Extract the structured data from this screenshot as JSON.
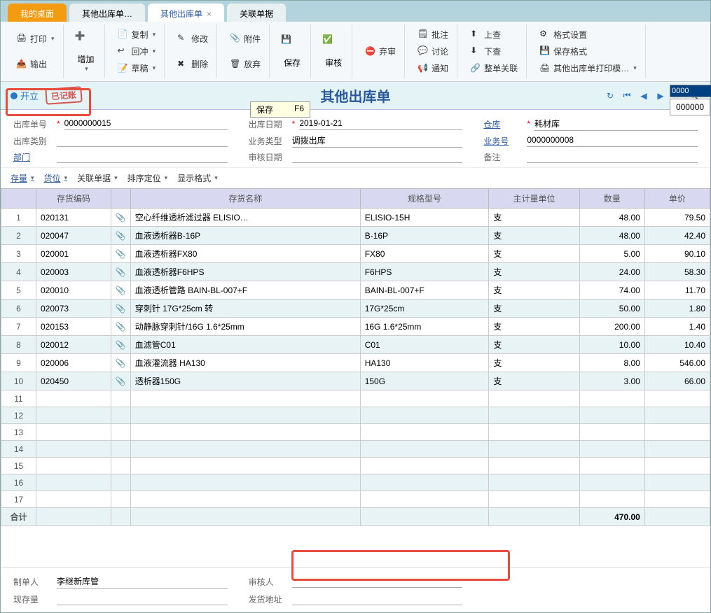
{
  "tabs": [
    {
      "label": "我的桌面",
      "active": "orange"
    },
    {
      "label": "其他出库单…"
    },
    {
      "label": "其他出库单",
      "active": "white",
      "closable": true
    },
    {
      "label": "关联单据"
    }
  ],
  "toolbar": {
    "print": "打印",
    "output": "输出",
    "add": "增加",
    "copy": "复制",
    "back": "回冲",
    "draft": "草稿",
    "modify": "修改",
    "delete": "删除",
    "attach": "附件",
    "discard": "放弃",
    "save": "保存",
    "audit": "审核",
    "unaudit": "弃审",
    "note": "批注",
    "discuss": "讨论",
    "notify": "通知",
    "up_check": "上查",
    "down_check": "下查",
    "link_all": "整单关联",
    "format": "格式设置",
    "save_format": "保存格式",
    "print_tmpl": "其他出库单打印模…"
  },
  "status": {
    "state": "开立",
    "stamp": "已记账",
    "title": "其他出库单",
    "tip_label": "保存",
    "tip_key": "F6",
    "search_value": "0000",
    "search_hint": "000000"
  },
  "form": {
    "doc_no_label": "出库单号",
    "doc_no": "0000000015",
    "out_type_label": "出库类别",
    "out_type": "",
    "dept_label": "部门",
    "dept": "",
    "date_label": "出库日期",
    "date": "2019-01-21",
    "biz_type_label": "业务类型",
    "biz_type": "调拨出库",
    "audit_date_label": "审核日期",
    "audit_date": "",
    "wh_label": "仓库",
    "wh": "耗材库",
    "biz_no_label": "业务号",
    "biz_no": "0000000008",
    "remark_label": "备注",
    "remark": ""
  },
  "midbar": {
    "stock": "存量",
    "loc": "货位",
    "link": "关联单据",
    "sort": "排序定位",
    "display": "显示格式"
  },
  "grid": {
    "headers": [
      "",
      "存货编码",
      "",
      "存货名称",
      "规格型号",
      "主计量单位",
      "数量",
      "单价"
    ],
    "rows": [
      {
        "n": 1,
        "code": "020131",
        "name": "空心纤维透析滤过器 ELISIO…",
        "spec": "ELISIO-15H",
        "unit": "支",
        "qty": "48.00",
        "price": "79.50"
      },
      {
        "n": 2,
        "code": "020047",
        "name": "血液透析器B-16P",
        "spec": "B-16P",
        "unit": "支",
        "qty": "48.00",
        "price": "42.40"
      },
      {
        "n": 3,
        "code": "020001",
        "name": "血液透析器FX80",
        "spec": "FX80",
        "unit": "支",
        "qty": "5.00",
        "price": "90.10"
      },
      {
        "n": 4,
        "code": "020003",
        "name": "血液透析器F6HPS",
        "spec": "F6HPS",
        "unit": "支",
        "qty": "24.00",
        "price": "58.30"
      },
      {
        "n": 5,
        "code": "020010",
        "name": "血液透析管路 BAIN-BL-007+F",
        "spec": "BAIN-BL-007+F",
        "unit": "支",
        "qty": "74.00",
        "price": "11.70"
      },
      {
        "n": 6,
        "code": "020073",
        "name": "穿刺针 17G*25cm 转",
        "spec": "17G*25cm",
        "unit": "支",
        "qty": "50.00",
        "price": "1.80"
      },
      {
        "n": 7,
        "code": "020153",
        "name": "动静脉穿刺针/16G 1.6*25mm",
        "spec": "16G 1.6*25mm",
        "unit": "支",
        "qty": "200.00",
        "price": "1.40"
      },
      {
        "n": 8,
        "code": "020012",
        "name": "血滤管C01",
        "spec": "C01",
        "unit": "支",
        "qty": "10.00",
        "price": "10.40"
      },
      {
        "n": 9,
        "code": "020006",
        "name": "血液灌流器 HA130",
        "spec": "HA130",
        "unit": "支",
        "qty": "8.00",
        "price": "546.00"
      },
      {
        "n": 10,
        "code": "020450",
        "name": "透析器150G",
        "spec": "150G",
        "unit": "支",
        "qty": "3.00",
        "price": "66.00"
      },
      {
        "n": 11
      },
      {
        "n": 12
      },
      {
        "n": 13
      },
      {
        "n": 14
      },
      {
        "n": 15
      },
      {
        "n": 16
      },
      {
        "n": 17
      }
    ],
    "total_label": "合计",
    "total_qty": "470.00"
  },
  "footer": {
    "creator_label": "制单人",
    "creator": "李继新库管",
    "auditor_label": "审核人",
    "auditor": "",
    "stock_label": "现存量",
    "stock": "",
    "addr_label": "发货地址",
    "addr": ""
  }
}
